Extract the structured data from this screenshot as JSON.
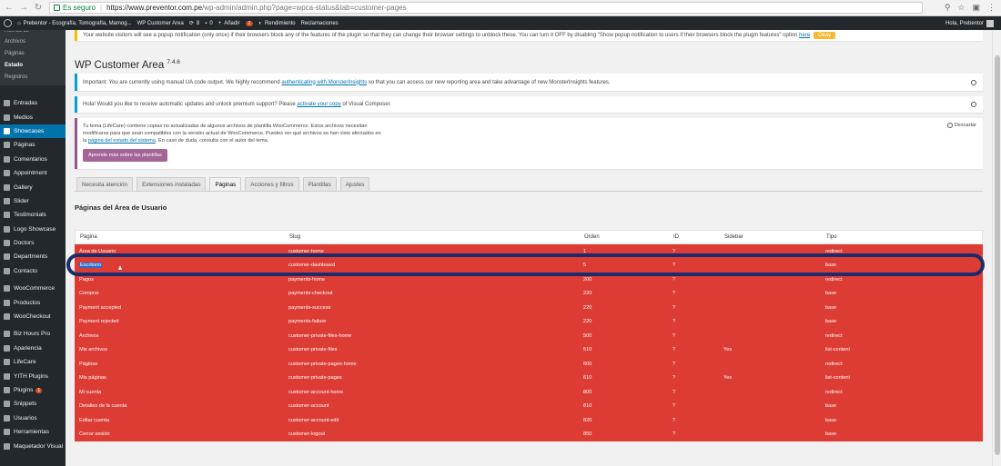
{
  "browser": {
    "secure_label": "Es seguro",
    "url_host": "https://www.preventor.com.pe",
    "url_path": "/wp-admin/admin.php?page=wpca-status&tab=customer-pages"
  },
  "adminbar": {
    "site_name": "Prebentor - Ecografía, Tomografía, Mamog...",
    "plugin": "WP Customer Area",
    "updates_count": "8",
    "comments_count": "0",
    "new_label": "Añadir",
    "badge_count": "2",
    "rendimiento": "Rendimiento",
    "reclamaciones": "Reclamaciones",
    "greeting": "Hola, Prebentor"
  },
  "sidebar": {
    "submenu": [
      {
        "label": "Acerca de"
      },
      {
        "label": "Archivos"
      },
      {
        "label": "Páginas"
      },
      {
        "label": "Estado"
      },
      {
        "label": "Registros"
      }
    ],
    "items": [
      {
        "label": "Entradas"
      },
      {
        "label": "Medios"
      },
      {
        "label": "Showcases"
      },
      {
        "label": "Páginas"
      },
      {
        "label": "Comentarios"
      },
      {
        "label": "Appointment"
      },
      {
        "label": "Gallery"
      },
      {
        "label": "Slider"
      },
      {
        "label": "Testimonials"
      },
      {
        "label": "Logo Showcase"
      },
      {
        "label": "Doctors"
      },
      {
        "label": "Departments"
      },
      {
        "label": "Contacto"
      },
      {
        "label": "WooCommerce"
      },
      {
        "label": "Productos"
      },
      {
        "label": "WooCheckout"
      },
      {
        "label": "Biz Hours Pro"
      },
      {
        "label": "Apariencia"
      },
      {
        "label": "LifeCare"
      },
      {
        "label": "YITH Plugins"
      },
      {
        "label": "Plugins",
        "badge": "1"
      },
      {
        "label": "Snippets"
      },
      {
        "label": "Usuarios"
      },
      {
        "label": "Herramientas"
      },
      {
        "label": "Maquetador Visual"
      }
    ]
  },
  "notices": {
    "popup": "Your website visitors will see a popup notification (only once) if their browsers block any of the features of the plugin so that they can change their browser settings to unblock these. You can turn it OFF by disabling \"Show popup notification to users if their browsers block the plugin features\" option",
    "popup_link": "here",
    "okay": "Okay",
    "monster_pre": "Important: You are currently using manual UA code output. We highly recommend",
    "monster_link": "authenticating with MonsterInsights",
    "monster_post": "so that you can access our new reporting area and take advantage of new MonsterInsights features.",
    "vc_pre": "Hola! Would you like to receive automatic updates and unlock premium support? Please",
    "vc_link": "activate your copy",
    "vc_post": "of Visual Composer.",
    "wc_text_1": "Tu tema (LifeCare) contiene copias no actualizadas de algunos archivos de plantilla WooCommerce. Estos archivos necesitan modificarse para que sean compatibles con la versión actual de WooCommerce. Puedes ver qué archivos se han visto afectados en la",
    "wc_link": "página del estado del sistema",
    "wc_text_2": ". En caso de duda, consulta con el autor del tema.",
    "wc_button": "Aprende más sobre las plantillas",
    "wc_dismiss": "Descartar"
  },
  "page": {
    "title": "WP Customer Area",
    "version": "7.4.6",
    "section": "Páginas del Área de Usuario"
  },
  "tabs": [
    {
      "label": "Necesita atención"
    },
    {
      "label": "Extensiones instaladas"
    },
    {
      "label": "Páginas"
    },
    {
      "label": "Acciones y filtros"
    },
    {
      "label": "Plantillas"
    },
    {
      "label": "Ajustes"
    }
  ],
  "table": {
    "headers": [
      "Página",
      "Slug",
      "Orden",
      "ID",
      "Sidebar",
      "Tipo"
    ],
    "rows": [
      [
        "Área de Usuario",
        "customer-home",
        "1",
        "?",
        "",
        "redirect"
      ],
      [
        "Escritorio",
        "customer-dashboard",
        "5",
        "?",
        "",
        "base"
      ],
      [
        "Pagos",
        "payments-home",
        "200",
        "?",
        "",
        "redirect"
      ],
      [
        "Comprar",
        "payments-checkout",
        "220",
        "?",
        "",
        "base"
      ],
      [
        "Payment accepted",
        "payments-success",
        "220",
        "?",
        "",
        "base"
      ],
      [
        "Payment rejected",
        "payments-failure",
        "220",
        "?",
        "",
        "base"
      ],
      [
        "Archivos",
        "customer-private-files-home",
        "500",
        "?",
        "",
        "redirect"
      ],
      [
        "Mis archivos",
        "customer-private-files",
        "510",
        "?",
        "Yes",
        "list-content"
      ],
      [
        "Páginas",
        "customer-private-pages-home",
        "600",
        "?",
        "",
        "redirect"
      ],
      [
        "Mis páginas",
        "customer-private-pages",
        "610",
        "?",
        "Yes",
        "list-content"
      ],
      [
        "Mi cuenta",
        "customer-account-home",
        "800",
        "?",
        "",
        "redirect"
      ],
      [
        "Detalles de la cuenta",
        "customer-account",
        "810",
        "?",
        "",
        "base"
      ],
      [
        "Editar cuenta",
        "customer-account-edit",
        "820",
        "?",
        "",
        "base"
      ],
      [
        "Cerrar sesión",
        "customer-logout",
        "850",
        "?",
        "",
        "base"
      ]
    ]
  },
  "colors": {
    "table_bg": "#dd3c35",
    "sidebar_bg": "#23282d",
    "active_menu": "#0073aa",
    "highlight_ring": "#1a2c6b"
  }
}
